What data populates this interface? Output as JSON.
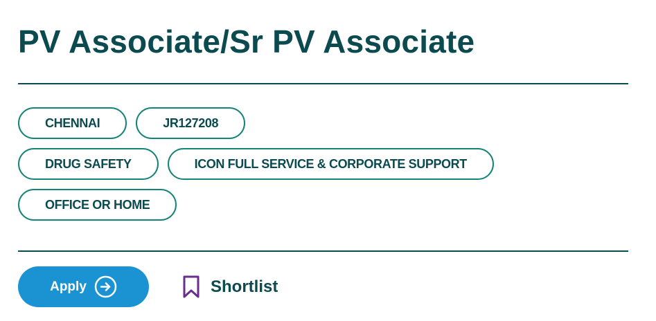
{
  "job": {
    "title": "PV Associate/Sr PV Associate"
  },
  "tags": {
    "location": "CHENNAI",
    "job_id": "JR127208",
    "category": "DRUG SAFETY",
    "business_unit": "ICON FULL SERVICE & CORPORATE SUPPORT",
    "work_mode": "OFFICE OR HOME"
  },
  "actions": {
    "apply_label": "Apply",
    "apply_icon": "arrow-circle-right-icon",
    "shortlist_label": "Shortlist",
    "shortlist_icon": "bookmark-icon"
  },
  "colors": {
    "title_text": "#0b4a4e",
    "tag_border": "#138477",
    "apply_background": "#1b93d3",
    "bookmark_icon": "#6b2d8a"
  }
}
